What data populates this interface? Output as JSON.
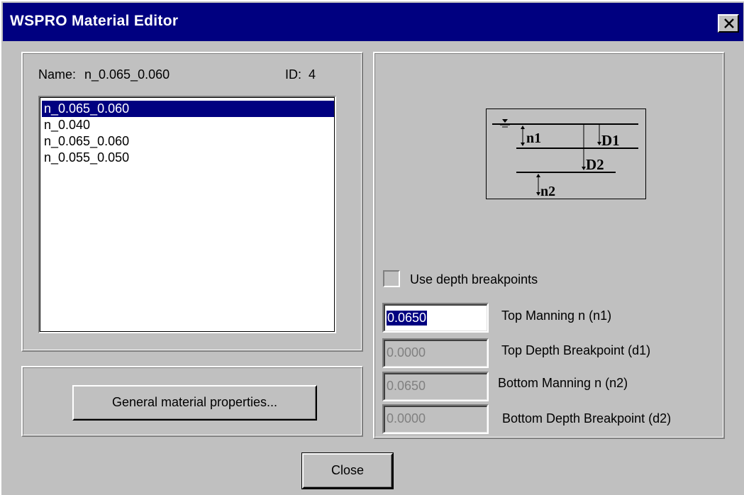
{
  "window": {
    "title": "WSPRO Material Editor"
  },
  "left_panel": {
    "name_label": "Name:",
    "name_value": "n_0.065_0.060",
    "id_label": "ID:",
    "id_value": "4",
    "list_items": [
      "n_0.065_0.060",
      "n_0.040",
      "n_0.065_0.060",
      "n_0.055_0.050"
    ],
    "selected_index": 0,
    "general_button": "General material properties..."
  },
  "diagram": {
    "label_n1": "n1",
    "label_d1": "D1",
    "label_d2": "D2",
    "label_n2": "n2"
  },
  "right_panel": {
    "checkbox_label": "Use depth breakpoints",
    "checkbox_checked": false,
    "fields": [
      {
        "value": "0.0650",
        "label": "Top Manning n (n1)",
        "enabled": true
      },
      {
        "value": "0.0000",
        "label": "Top Depth Breakpoint (d1)",
        "enabled": false
      },
      {
        "value": "0.0650",
        "label": "Bottom Manning n (n2)",
        "enabled": false
      },
      {
        "value": "0.0000",
        "label": "Bottom Depth Breakpoint (d2)",
        "enabled": false
      }
    ]
  },
  "footer": {
    "close_button": "Close"
  },
  "colors": {
    "titlebar": "#000080",
    "face": "#c0c0c0",
    "selection": "#000080"
  }
}
